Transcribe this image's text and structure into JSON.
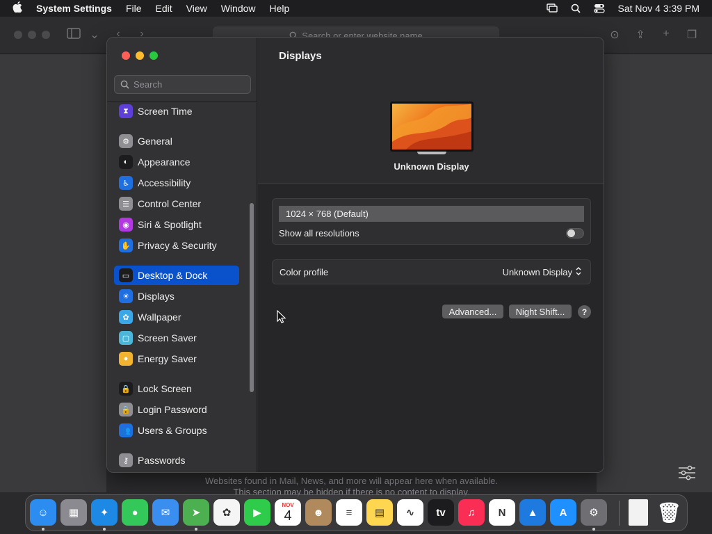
{
  "menubar": {
    "app_name": "System Settings",
    "menus": [
      "File",
      "Edit",
      "View",
      "Window",
      "Help"
    ],
    "datetime": "Sat Nov 4  3:39 PM"
  },
  "safari": {
    "address_placeholder": "Search or enter website name",
    "bottom_text_1": "Websites found in Mail, News, and more will appear here when available.",
    "bottom_text_2": "This section may be hidden if there is no content to display."
  },
  "sidebar": {
    "search_placeholder": "Search",
    "items": [
      {
        "label": "Screen Time",
        "icon": "hourglass-icon",
        "color": "#5e3fd8"
      },
      {
        "label": "General",
        "icon": "gear-icon",
        "color": "#8e8e93"
      },
      {
        "label": "Appearance",
        "icon": "appearance-icon",
        "color": "#1c1c1e"
      },
      {
        "label": "Accessibility",
        "icon": "accessibility-icon",
        "color": "#1f6fe0"
      },
      {
        "label": "Control Center",
        "icon": "control-center-icon",
        "color": "#8e8e93"
      },
      {
        "label": "Siri & Spotlight",
        "icon": "siri-icon",
        "color": "#b03adf"
      },
      {
        "label": "Privacy & Security",
        "icon": "hand-icon",
        "color": "#1f6fe0"
      },
      {
        "label": "Desktop & Dock",
        "icon": "dock-icon",
        "color": "#1c1c1e"
      },
      {
        "label": "Displays",
        "icon": "sun-icon",
        "color": "#1f6fe0"
      },
      {
        "label": "Wallpaper",
        "icon": "flower-icon",
        "color": "#3aa7e8"
      },
      {
        "label": "Screen Saver",
        "icon": "screen-saver-icon",
        "color": "#4bb6d9"
      },
      {
        "label": "Energy Saver",
        "icon": "lightbulb-icon",
        "color": "#f2b430"
      },
      {
        "label": "Lock Screen",
        "icon": "lock-icon",
        "color": "#1c1c1e"
      },
      {
        "label": "Login Password",
        "icon": "padlock-icon",
        "color": "#8e8e93"
      },
      {
        "label": "Users & Groups",
        "icon": "users-icon",
        "color": "#1f6fe0"
      },
      {
        "label": "Passwords",
        "icon": "key-icon",
        "color": "#8e8e93"
      }
    ],
    "selected_index": 7
  },
  "main": {
    "title": "Displays",
    "display_name": "Unknown Display",
    "resolution": "1024 × 768 (Default)",
    "show_all_label": "Show all resolutions",
    "show_all_enabled": false,
    "color_profile_label": "Color profile",
    "color_profile_value": "Unknown Display",
    "advanced_label": "Advanced...",
    "night_shift_label": "Night Shift...",
    "help_label": "?"
  },
  "dock": {
    "apps": [
      {
        "name": "finder",
        "glyph": "☺",
        "color": "#2d8cf0"
      },
      {
        "name": "launchpad",
        "glyph": "▦",
        "color": "#8a8a90"
      },
      {
        "name": "safari",
        "glyph": "✦",
        "color": "#1e88e5"
      },
      {
        "name": "messages",
        "glyph": "●",
        "color": "#34c759"
      },
      {
        "name": "mail",
        "glyph": "✉",
        "color": "#3a8ef0"
      },
      {
        "name": "maps",
        "glyph": "➤",
        "color": "#4caf50"
      },
      {
        "name": "photos",
        "glyph": "✿",
        "color": "#f5f5f5"
      },
      {
        "name": "facetime",
        "glyph": "▶",
        "color": "#2ecc4a"
      },
      {
        "name": "calendar",
        "glyph": "4",
        "color": "#ffffff",
        "month": "NOV"
      },
      {
        "name": "contacts",
        "glyph": "☻",
        "color": "#b08a5c"
      },
      {
        "name": "reminders",
        "glyph": "≡",
        "color": "#ffffff"
      },
      {
        "name": "notes",
        "glyph": "▤",
        "color": "#ffd64f"
      },
      {
        "name": "freeform",
        "glyph": "∿",
        "color": "#ffffff"
      },
      {
        "name": "tv",
        "glyph": "tv",
        "color": "#1c1c1e"
      },
      {
        "name": "music",
        "glyph": "♫",
        "color": "#fa2d55"
      },
      {
        "name": "news",
        "glyph": "N",
        "color": "#ffffff"
      },
      {
        "name": "keynote",
        "glyph": "▲",
        "color": "#1f7ae0"
      },
      {
        "name": "app-store",
        "glyph": "A",
        "color": "#1e90ff"
      },
      {
        "name": "system-settings",
        "glyph": "⚙",
        "color": "#6e6e73"
      },
      {
        "name": "document",
        "glyph": "",
        "color": "#f2f2f2"
      },
      {
        "name": "trash",
        "glyph": "🗑",
        "color": "#9a9aa0"
      }
    ]
  }
}
